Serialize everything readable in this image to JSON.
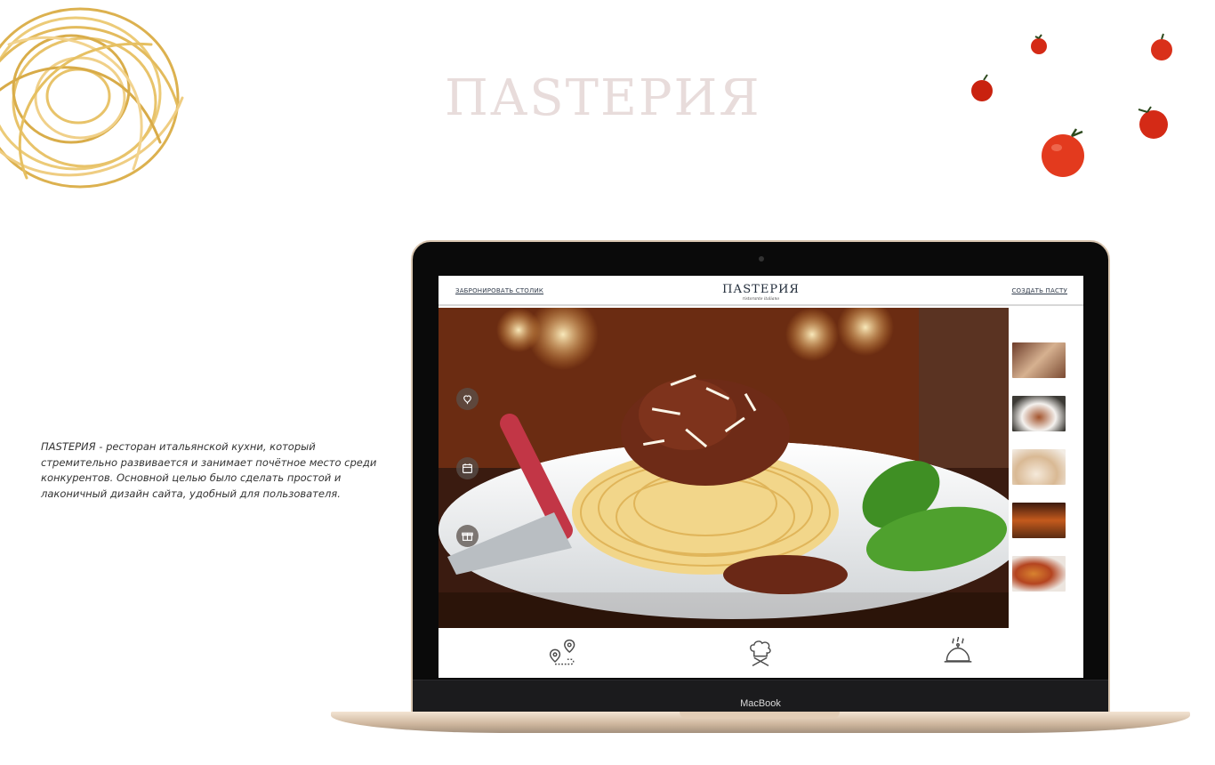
{
  "hero": {
    "title": "ПАSTЕРИЯ"
  },
  "description": "ПАSTЕРИЯ - ресторан итальянской кухни, который стремительно развивается и занимает почётное место среди конкурентов. Основной целью было сделать простой и лаконичный дизайн сайта, удобный для пользователя.",
  "laptop": {
    "label": "MacBook"
  },
  "site": {
    "nav": {
      "book_table": "ЗАБРОНИРОВАТЬ СТОЛИК",
      "create_pasta": "СОЗДАТЬ ПАСТУ",
      "logo": "ПАSTЕРИЯ",
      "logo_sub": "ristorante italiano"
    },
    "side_icons": [
      "heart-balloon-icon",
      "calendar-icon",
      "gift-icon"
    ],
    "thumbnails": [
      "restaurant-thumb",
      "steak-thumb",
      "table-setting-thumb",
      "oven-thumb",
      "pizza-thumb"
    ],
    "bottom_icons": [
      "map-location-icon",
      "chef-hat-icon",
      "serving-dish-icon"
    ]
  },
  "colors": {
    "title_tint": "#e8dcdb",
    "nav_text": "#2f3a4a",
    "laptop_gold": "#d9c6b0"
  }
}
